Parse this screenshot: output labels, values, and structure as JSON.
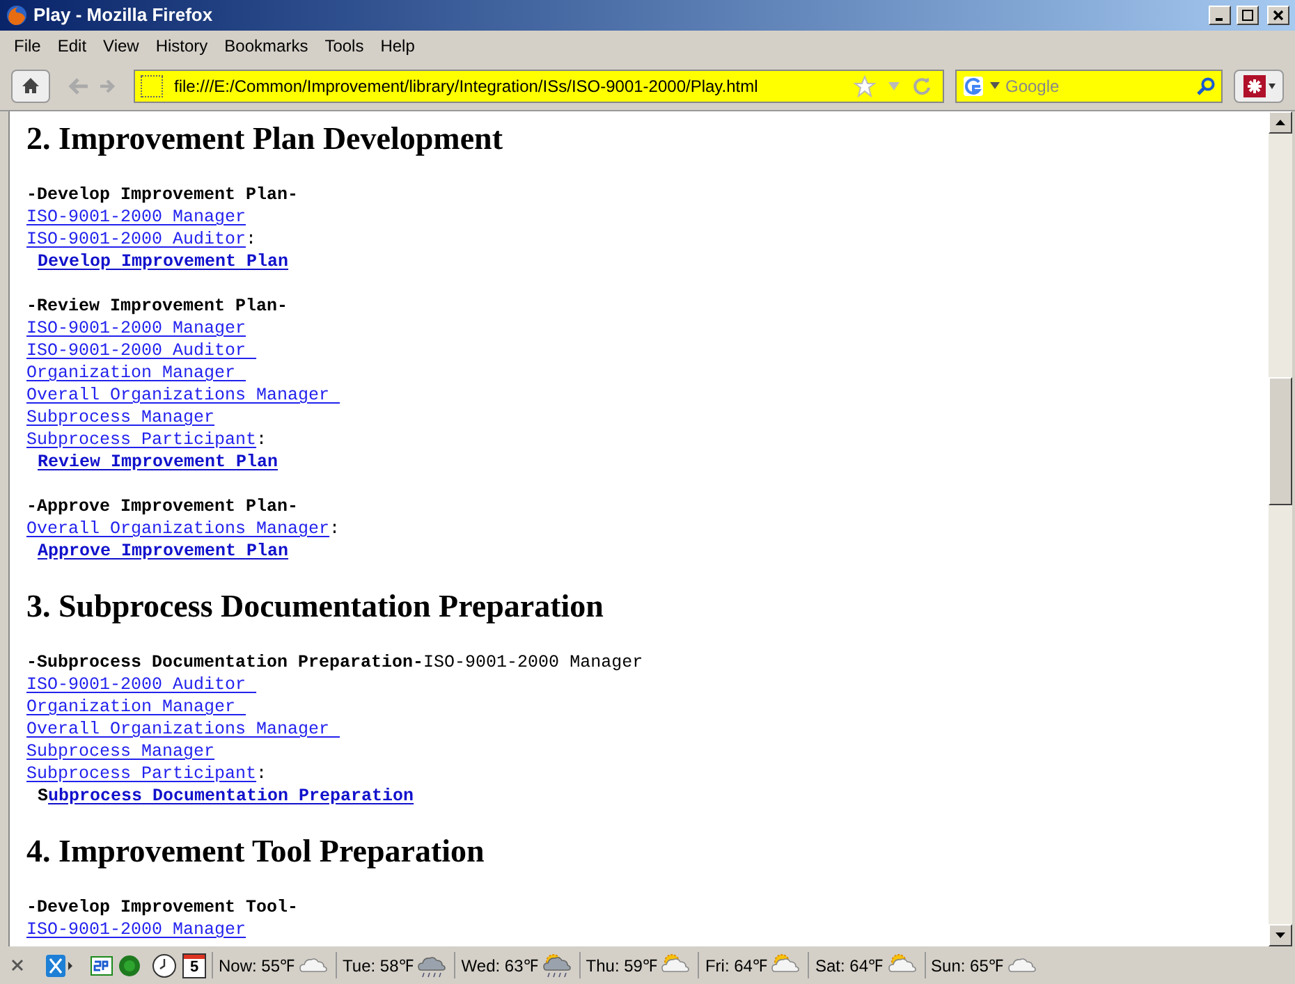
{
  "window": {
    "title": "Play - Mozilla Firefox"
  },
  "menu": [
    "File",
    "Edit",
    "View",
    "History",
    "Bookmarks",
    "Tools",
    "Help"
  ],
  "address": {
    "value": "file:///E:/Common/Improvement/library/Integration/ISs/ISO-9001-2000/Play.html"
  },
  "search": {
    "placeholder": "Google"
  },
  "sections": [
    {
      "heading": "2. Improvement Plan Development",
      "blocks": [
        [
          {
            "kind": "title",
            "parts": [
              {
                "kind": "bold",
                "text": "-Develop Improvement Plan-"
              }
            ]
          },
          {
            "kind": "role",
            "parts": [
              {
                "kind": "link",
                "text": "ISO-9001-2000 Manager"
              }
            ]
          },
          {
            "kind": "role",
            "parts": [
              {
                "kind": "link",
                "text": "ISO-9001-2000 Auditor"
              },
              {
                "kind": "plain",
                "text": ":"
              }
            ]
          },
          {
            "kind": "action",
            "parts": [
              {
                "kind": "boldlink",
                "text": "Develop Improvement Plan"
              }
            ]
          }
        ],
        [
          {
            "kind": "title",
            "parts": [
              {
                "kind": "bold",
                "text": "-Review Improvement Plan-"
              }
            ]
          },
          {
            "kind": "role",
            "parts": [
              {
                "kind": "link",
                "text": "ISO-9001-2000 Manager"
              }
            ]
          },
          {
            "kind": "role",
            "parts": [
              {
                "kind": "link",
                "text": "ISO-9001-2000 Auditor "
              }
            ]
          },
          {
            "kind": "role",
            "parts": [
              {
                "kind": "link",
                "text": "Organization Manager "
              }
            ]
          },
          {
            "kind": "role",
            "parts": [
              {
                "kind": "link",
                "text": "Overall Organizations Manager "
              }
            ]
          },
          {
            "kind": "role",
            "parts": [
              {
                "kind": "link",
                "text": "Subprocess Manager"
              }
            ]
          },
          {
            "kind": "role",
            "parts": [
              {
                "kind": "link",
                "text": "Subprocess Participant"
              },
              {
                "kind": "plain",
                "text": ":"
              }
            ]
          },
          {
            "kind": "action",
            "parts": [
              {
                "kind": "boldlink",
                "text": "Review Improvement Plan"
              }
            ]
          }
        ],
        [
          {
            "kind": "title",
            "parts": [
              {
                "kind": "bold",
                "text": "-Approve Improvement Plan-"
              }
            ]
          },
          {
            "kind": "role",
            "parts": [
              {
                "kind": "link",
                "text": "Overall Organizations Manager"
              },
              {
                "kind": "plain",
                "text": ":"
              }
            ]
          },
          {
            "kind": "action",
            "parts": [
              {
                "kind": "boldlink",
                "text": "Approve Improvement Plan"
              }
            ]
          }
        ]
      ]
    },
    {
      "heading": "3. Subprocess Documentation Preparation",
      "blocks": [
        [
          {
            "kind": "title",
            "parts": [
              {
                "kind": "bold",
                "text": "-Subprocess Documentation Preparation-"
              },
              {
                "kind": "plain",
                "text": "ISO-9001-2000 Manager"
              }
            ]
          },
          {
            "kind": "role",
            "parts": [
              {
                "kind": "link",
                "text": "ISO-9001-2000 Auditor "
              }
            ]
          },
          {
            "kind": "role",
            "parts": [
              {
                "kind": "link",
                "text": "Organization Manager "
              }
            ]
          },
          {
            "kind": "role",
            "parts": [
              {
                "kind": "link",
                "text": "Overall Organizations Manager "
              }
            ]
          },
          {
            "kind": "role",
            "parts": [
              {
                "kind": "link",
                "text": "Subprocess Manager"
              }
            ]
          },
          {
            "kind": "role",
            "parts": [
              {
                "kind": "link",
                "text": "Subprocess Participant"
              },
              {
                "kind": "plain",
                "text": ":"
              }
            ]
          },
          {
            "kind": "action",
            "parts": [
              {
                "kind": "bold",
                "text": "S"
              },
              {
                "kind": "boldlink",
                "text": "ubprocess Documentation Preparation"
              }
            ]
          }
        ]
      ]
    },
    {
      "heading": "4. Improvement Tool Preparation",
      "blocks": [
        [
          {
            "kind": "title",
            "parts": [
              {
                "kind": "bold",
                "text": "-Develop Improvement Tool-"
              }
            ]
          },
          {
            "kind": "role",
            "parts": [
              {
                "kind": "link",
                "text": "ISO-9001-2000 Manager"
              }
            ]
          }
        ]
      ]
    }
  ],
  "status": {
    "calendar_day": "5",
    "weather": [
      {
        "label": "Now: 55℉",
        "kind": "cloud"
      },
      {
        "label": "Tue: 58℉",
        "kind": "rain"
      },
      {
        "label": "Wed: 63℉",
        "kind": "sunrain"
      },
      {
        "label": "Thu: 59℉",
        "kind": "suncloud"
      },
      {
        "label": "Fri: 64℉",
        "kind": "suncloud"
      },
      {
        "label": "Sat: 64℉",
        "kind": "suncloud"
      },
      {
        "label": "Sun: 65℉",
        "kind": "cloud"
      }
    ]
  }
}
